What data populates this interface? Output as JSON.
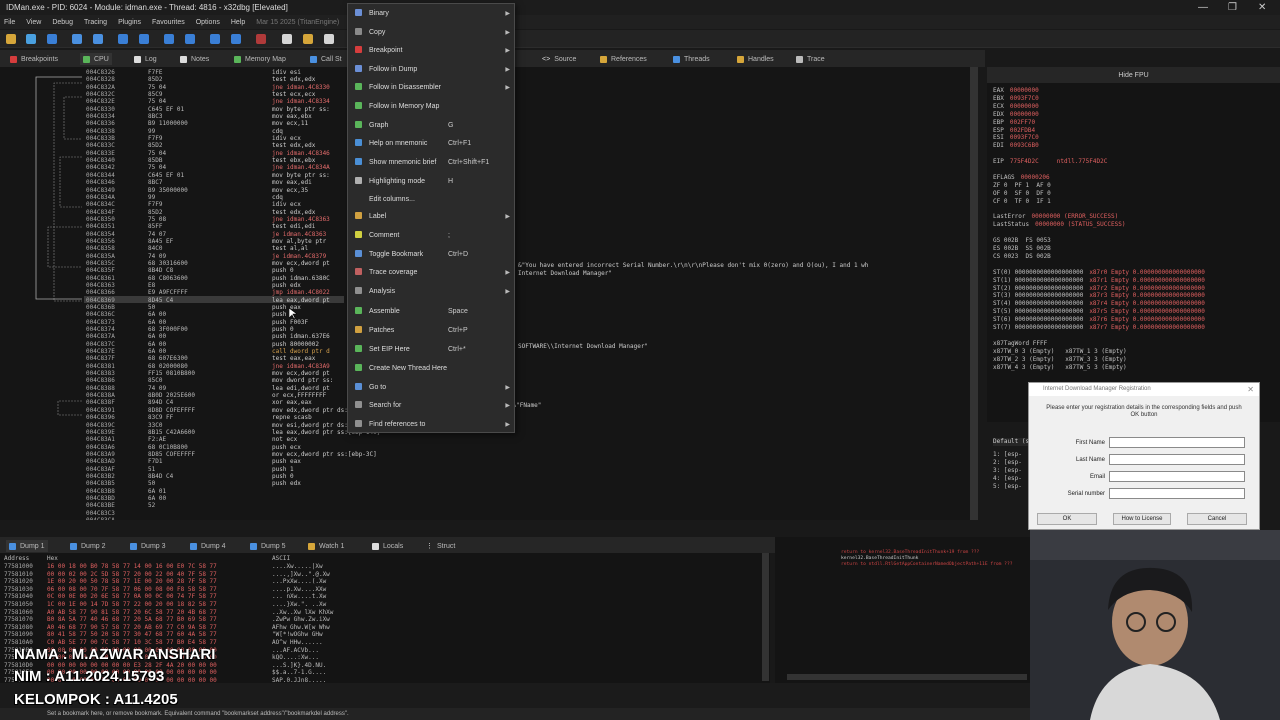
{
  "window": {
    "title": "IDMan.exe - PID: 6024 - Module: idman.exe - Thread: 4816 - x32dbg [Elevated]"
  },
  "menubar": {
    "items": [
      "File",
      "View",
      "Debug",
      "Tracing",
      "Plugins",
      "Favourites",
      "Options",
      "Help"
    ],
    "date": "Mar 15 2025 (TitanEngine)"
  },
  "tabs": [
    "Breakpoints",
    "CPU",
    "Log",
    "Notes",
    "Memory Map",
    "Call St",
    "Source",
    "References",
    "Threads",
    "Handles",
    "Trace"
  ],
  "cpu": {
    "addresses": [
      "004C8326",
      "004C8328",
      "004C832A",
      "004C832C",
      "004C832E",
      "004C8330",
      "004C8334",
      "004C8336",
      "004C8338",
      "004C833B",
      "004C833C",
      "004C833E",
      "004C8340",
      "004C8342",
      "004C8344",
      "004C8346",
      "004C8349",
      "004C834A",
      "004C834C",
      "004C834F",
      "004C8350",
      "004C8351",
      "004C8354",
      "004C8356",
      "004C8358",
      "004C835A",
      "004C835C",
      "004C835F",
      "004C8361",
      "004C8363",
      "004C8366",
      "004C8369",
      "004C836B",
      "004C836C",
      "004C8373",
      "004C8374",
      "004C837A",
      "004C837C",
      "004C837E",
      "004C837F",
      "004C8381",
      "004C8383",
      "004C8386",
      "004C8388",
      "004C838A",
      "004C838F",
      "004C8391",
      "004C8396",
      "004C839C",
      "004C839E",
      "004C83A1",
      "004C83A6",
      "004C83A9",
      "004C83AD",
      "004C83AF",
      "004C83B2",
      "004C83B5",
      "004C83B8",
      "004C83BD",
      "004C83BE",
      "004C83C3",
      "004C83CA",
      "004C83CC",
      "004C83CF",
      "004C83D1",
      "004C83D3",
      "004C83D5"
    ],
    "bytes": [
      "F7FE",
      "85D2",
      "75 04",
      "85C9",
      "75 04",
      "C645 EF 01",
      "8BC3",
      "B9 11000000",
      "99",
      "F7F9",
      "85D2",
      "75 04",
      "85DB",
      "75 04",
      "C645 EF 01",
      "8BC7",
      "B9 35000000",
      "99",
      "F7F9",
      "85D2",
      "75 08",
      "85FF",
      "74 07",
      "8A45 EF",
      "84C0",
      "74 09",
      "68 30316600",
      "8B4D C8",
      "68 C8063600",
      "E8",
      "E9 A9FCFFFF",
      "8D45 C4",
      "50",
      "6A 00",
      "6A 00",
      "68 3F000F00",
      "6A 00",
      "6A 00",
      "6A 00",
      "68 607E6300",
      "68 02000080",
      "FF15 0810B800",
      "85C0",
      "74 09",
      "8B0D 2025E600",
      "894D C4",
      "8D8D COFEFFFF",
      "83C9 FF",
      "33C0",
      "8B15 C42A6600",
      "F2:AE",
      "68 0C10B800",
      "8D85 COFEFFFF",
      "F7D1",
      "51",
      "8B4D C4",
      "50",
      "6A 01",
      "6A 00",
      "52"
    ],
    "asm": [
      {
        "t": "idiv esi",
        "k": ""
      },
      {
        "t": "test edx,edx",
        "k": ""
      },
      {
        "t": "jne idman.4C8330",
        "k": "j"
      },
      {
        "t": "test ecx,ecx",
        "k": ""
      },
      {
        "t": "jne idman.4C8334",
        "k": "j"
      },
      {
        "t": "mov byte ptr ss:",
        "k": ""
      },
      {
        "t": "mov eax,ebx",
        "k": ""
      },
      {
        "t": "mov ecx,11",
        "k": ""
      },
      {
        "t": "cdq",
        "k": ""
      },
      {
        "t": "idiv ecx",
        "k": ""
      },
      {
        "t": "test edx,edx",
        "k": ""
      },
      {
        "t": "jne idman.4C8346",
        "k": "j"
      },
      {
        "t": "test ebx,ebx",
        "k": ""
      },
      {
        "t": "jne idman.4C834A",
        "k": "j"
      },
      {
        "t": "mov byte ptr ss:",
        "k": ""
      },
      {
        "t": "mov eax,edi",
        "k": ""
      },
      {
        "t": "mov ecx,35",
        "k": ""
      },
      {
        "t": "cdq",
        "k": ""
      },
      {
        "t": "idiv ecx",
        "k": ""
      },
      {
        "t": "test edx,edx",
        "k": ""
      },
      {
        "t": "jne idman.4C8363",
        "k": "j"
      },
      {
        "t": "test edi,edi",
        "k": ""
      },
      {
        "t": "je idman.4C8363",
        "k": "j"
      },
      {
        "t": "mov al,byte ptr",
        "k": ""
      },
      {
        "t": "test al,al",
        "k": ""
      },
      {
        "t": "je idman.4C8379",
        "k": "j"
      },
      {
        "t": "mov ecx,dword pt",
        "k": ""
      },
      {
        "t": "push 0",
        "k": ""
      },
      {
        "t": "push idman.6380C",
        "k": ""
      },
      {
        "t": "push edx",
        "k": ""
      },
      {
        "t": "jmp idman.4C8022",
        "k": "j"
      },
      {
        "t": "lea eax,dword pt",
        "k": ""
      },
      {
        "t": "push eax",
        "k": ""
      },
      {
        "t": "push 0",
        "k": ""
      },
      {
        "t": "push F003F",
        "k": ""
      },
      {
        "t": "push 0",
        "k": ""
      },
      {
        "t": "push idman.637E6",
        "k": ""
      },
      {
        "t": "push 80000002",
        "k": ""
      },
      {
        "t": "call dword ptr d",
        "k": "c"
      },
      {
        "t": "test eax,eax",
        "k": ""
      },
      {
        "t": "jne idman.4C83A9",
        "k": "j"
      },
      {
        "t": "mov ecx,dword pt",
        "k": ""
      },
      {
        "t": "mov dword ptr ss:",
        "k": ""
      },
      {
        "t": "lea edi,dword pt",
        "k": ""
      },
      {
        "t": "or ecx,FFFFFFFF",
        "k": ""
      },
      {
        "t": "xor eax,eax",
        "k": ""
      },
      {
        "t": "mov edx,dword ptr ds:[662AC4]",
        "k": ""
      },
      {
        "t": "repne scasb",
        "k": ""
      },
      {
        "t": "mov esi,dword ptr ds:[<RegSetValueExA>]",
        "k": ""
      },
      {
        "t": "lea eax,dword ptr ss:[ebp-140]",
        "k": ""
      },
      {
        "t": "not ecx",
        "k": ""
      },
      {
        "t": "push ecx",
        "k": ""
      },
      {
        "t": "mov ecx,dword ptr ss:[ebp-3C]",
        "k": ""
      },
      {
        "t": "push eax",
        "k": ""
      },
      {
        "t": "push 1",
        "k": ""
      },
      {
        "t": "push 0",
        "k": ""
      },
      {
        "t": "push edx",
        "k": ""
      }
    ],
    "comments": [
      "&\"You have entered incorrect Serial Number.\\r\\n\\r\\nPlease don't mix 0(zero) and O(ou), I and 1 wh",
      "Internet Download Manager\"",
      "SOFTWARE\\\\Internet Download Manager\"",
      "00662AC4:&\"FName\""
    ]
  },
  "context_menu": {
    "items": [
      {
        "label": "Binary",
        "shortcut": "",
        "submenu": true,
        "color": "#6b8fd6"
      },
      {
        "label": "Copy",
        "shortcut": "",
        "submenu": true,
        "color": "#8a8a8a"
      },
      {
        "label": "Breakpoint",
        "shortcut": "",
        "submenu": true,
        "color": "#d63d3d"
      },
      {
        "label": "Follow in Dump",
        "shortcut": "",
        "submenu": true,
        "color": "#6b8fd6"
      },
      {
        "label": "Follow in Disassembler",
        "shortcut": "",
        "submenu": true,
        "color": "#5ab55a"
      },
      {
        "label": "Follow in Memory Map",
        "shortcut": "",
        "submenu": false,
        "color": "#5ab55a"
      },
      {
        "label": "Graph",
        "shortcut": "G",
        "submenu": false,
        "color": "#5ab55a"
      },
      {
        "label": "Help on mnemonic",
        "shortcut": "Ctrl+F1",
        "submenu": false,
        "color": "#4a8fd6"
      },
      {
        "label": "Show mnemonic brief",
        "shortcut": "Ctrl+Shift+F1",
        "submenu": false,
        "color": "#4a8fd6"
      },
      {
        "label": "Highlighting mode",
        "shortcut": "H",
        "submenu": false,
        "color": "#b0b0b0"
      },
      {
        "label": "Edit columns...",
        "shortcut": "",
        "submenu": false,
        "color": ""
      },
      {
        "label": "Label",
        "shortcut": "",
        "submenu": true,
        "color": "#d0a040"
      },
      {
        "label": "Comment",
        "shortcut": ";",
        "submenu": false,
        "color": "#d0d040"
      },
      {
        "label": "Toggle Bookmark",
        "shortcut": "Ctrl+D",
        "submenu": false,
        "color": "#5a8fd6"
      },
      {
        "label": "Trace coverage",
        "shortcut": "",
        "submenu": true,
        "color": "#c06060"
      },
      {
        "label": "Analysis",
        "shortcut": "",
        "submenu": true,
        "color": "#909090"
      },
      {
        "label": "Assemble",
        "shortcut": "Space",
        "submenu": false,
        "color": "#5ab55a"
      },
      {
        "label": "Patches",
        "shortcut": "Ctrl+P",
        "submenu": false,
        "color": "#d0a040"
      },
      {
        "label": "Set EIP Here",
        "shortcut": "Ctrl+*",
        "submenu": false,
        "color": "#5ab55a"
      },
      {
        "label": "Create New Thread Here",
        "shortcut": "",
        "submenu": false,
        "color": "#5ab55a"
      },
      {
        "label": "Go to",
        "shortcut": "",
        "submenu": true,
        "color": "#5a8fd6"
      },
      {
        "label": "Search for",
        "shortcut": "",
        "submenu": true,
        "color": "#909090"
      },
      {
        "label": "Find references to",
        "shortcut": "",
        "submenu": true,
        "color": "#909090"
      }
    ]
  },
  "registers": {
    "header": "Hide FPU",
    "lines": [
      [
        "EAX",
        "00000000",
        ""
      ],
      [
        "EBX",
        "0093F7C0",
        ""
      ],
      [
        "ECX",
        "00000000",
        ""
      ],
      [
        "EDX",
        "00000000",
        ""
      ],
      [
        "EBP",
        "002FF70",
        ""
      ],
      [
        "ESP",
        "002FDB4",
        ""
      ],
      [
        "ESI",
        "0093F7C0",
        ""
      ],
      [
        "EDI",
        "0093C6B0",
        ""
      ],
      [
        "",
        "",
        " "
      ],
      [
        "EIP",
        "775F4D2C",
        "ntdll.775F4D2C"
      ],
      [
        "",
        "",
        " "
      ],
      [
        "EFLAGS",
        "00000206",
        ""
      ],
      [
        "ZF 0  PF 1  AF 0",
        "",
        ""
      ],
      [
        "OF 0  SF 0  DF 0",
        "",
        ""
      ],
      [
        "CF 0  TF 0  IF 1",
        "",
        ""
      ],
      [
        "",
        "",
        " "
      ],
      [
        "LastError",
        "00000000 (ERROR_SUCCESS)",
        ""
      ],
      [
        "LastStatus",
        "00000000 (STATUS_SUCCESS)",
        ""
      ],
      [
        "",
        "",
        " "
      ],
      [
        "GS 002B  FS 0053",
        "",
        ""
      ],
      [
        "ES 002B  SS 002B",
        "",
        ""
      ],
      [
        "CS 0023  DS 002B",
        "",
        ""
      ],
      [
        "",
        "",
        " "
      ],
      [
        "ST(0) 0000000000000000000",
        "x87r0 Empty 0.000000000000000000",
        ""
      ],
      [
        "ST(1) 0000000000000000000",
        "x87r1 Empty 0.000000000000000000",
        ""
      ],
      [
        "ST(2) 0000000000000000000",
        "x87r2 Empty 0.000000000000000000",
        ""
      ],
      [
        "ST(3) 0000000000000000000",
        "x87r3 Empty 0.000000000000000000",
        ""
      ],
      [
        "ST(4) 0000000000000000000",
        "x87r4 Empty 0.000000000000000000",
        ""
      ],
      [
        "ST(5) 0000000000000000000",
        "x87r5 Empty 0.000000000000000000",
        ""
      ],
      [
        "ST(6) 0000000000000000000",
        "x87r6 Empty 0.000000000000000000",
        ""
      ],
      [
        "ST(7) 0000000000000000000",
        "x87r7 Empty 0.000000000000000000",
        ""
      ],
      [
        "",
        "",
        " "
      ],
      [
        "x87TagWord FFFF",
        "",
        ""
      ],
      [
        "x87TW_0 3 (Empty)   x87TW_1 3 (Empty)",
        "",
        ""
      ],
      [
        "x87TW_2 3 (Empty)   x87TW_3 3 (Empty)",
        "",
        ""
      ],
      [
        "x87TW_4 3 (Empty)   x87TW_5 3 (Empty)",
        "",
        ""
      ]
    ],
    "default_label": "Default (st",
    "stack_args": [
      "1: [esp-",
      "2: [esp-",
      "3: [esp-",
      "4: [esp-",
      "5: [esp-"
    ]
  },
  "dialog": {
    "title": "Internet Download Manager Registration",
    "message": "Please enter your registration details in the corresponding fields and push OK button",
    "fields": [
      "First Name",
      "Last Name",
      "Email",
      "Serial number"
    ],
    "buttons": {
      "ok": "OK",
      "how": "How to License",
      "cancel": "Cancel"
    }
  },
  "bottom_tabs": [
    "Dump 1",
    "Dump 2",
    "Dump 3",
    "Dump 4",
    "Dump 5",
    "Watch 1",
    "Locals",
    "Struct"
  ],
  "dump": {
    "headers": {
      "address": "Address",
      "hex": "Hex",
      "ascii": "ASCII"
    },
    "rows": [
      {
        "a": "77581000",
        "h": "16 00 18 00  B0 78 58 77  14 00 16 00  E0 7C 58 77",
        "s": "....Xw.....|Xw"
      },
      {
        "a": "77581010",
        "h": "00 00 02 00  2C 5D 58 77  20 00 22 00  40 7F 58 77",
        "s": "....,]Xw..\".@.Xw"
      },
      {
        "a": "77581020",
        "h": "1E 00 20 00  50 78 58 77  1E 00 20 00  28 7F 58 77",
        "s": "...PxXw....(.Xw"
      },
      {
        "a": "77581030",
        "h": "06 00 08 00  70 7F 58 77  06 00 08 00  F8 58 58 77",
        "s": "....p.Xw....XXw"
      },
      {
        "a": "77581040",
        "h": "0C 00 0E 00  20 6E 58 77  0A 00 0C 00  74 7F 58 77",
        "s": "... nXw....t.Xw"
      },
      {
        "a": "77581050",
        "h": "1C 00 1E 00  14 7D 58 77  22 00 20 00  18 82 58 77",
        "s": "....}Xw.\". ..Xw"
      },
      {
        "a": "77581060",
        "h": "A0 AB 58 77  90 81 58 77  20 6C 58 77  20 4B 68 77",
        "s": "..Xw..Xw lXw KhXw"
      },
      {
        "a": "77581070",
        "h": "B0 8A 5A 77  40 46 68 77  20 5A 68 77  B0 69 58 77",
        "s": ".ZwPw Ghw.Zw.iXw"
      },
      {
        "a": "77581080",
        "h": "A0 46 68 77  90 57 58 77  20 AB 69 77  C0 9A 58 77",
        "s": "AFhw Ghw.W[w Whw"
      },
      {
        "a": "77581090",
        "h": "80 41 58 77  50 20 58 77  30 47 68 77  60 4A 58 77",
        "s": "\"W[*!wOGhw GHw"
      },
      {
        "a": "775810A0",
        "h": "C0 AB 5E 77  00 7C 58 77  10 3C 58 77  B0 E4 58 77",
        "s": "AO^w HHw......"
      },
      {
        "a": "775810B0",
        "h": "00 00 00 00  00 00 00 00  00 00 00 00  00 00 00 00",
        "s": "...AF.ACVb..."
      },
      {
        "a": "775810C0",
        "h": "10 00 00 00  00 00 00 00  00 00 00 00  00 00 00 00",
        "s": "kQO....:Xw..."
      },
      {
        "a": "775810D0",
        "h": "00 00 00 00  00 00 00 00  E3 28 2F 4A  20 00 00 00",
        "s": "...S.]K}.4D.NU."
      },
      {
        "a": "775810E0",
        "h": "00 00 00 00  00 00 00 00  00 00 00 00  00 00 00 00",
        "s": "$$.a..7-1.G...."
      },
      {
        "a": "775810F0",
        "h": "00 00 00 00  00 00 00 00  00 00 00 00  00 00 00 00",
        "s": "SAP.0.JJn8....."
      }
    ]
  },
  "stack": {
    "lines": [
      "return to kernel32.BaseThreadInitThunk+19 from ???",
      "kernel32.BaseThreadInitThunk",
      "return to ntdll.RtlGetAppContainerNamedObjectPath+11E from ???"
    ]
  },
  "overlay": {
    "name": "NAMA : M.AZWAR ANSHARI",
    "nim": "NIM : A11.2024.15793",
    "group": "KELOMPOK : A11.4205"
  },
  "status": "Set a bookmark here, or remove bookmark. Equivalent command \"bookmarkset address\"/\"bookmarkdel address\"."
}
